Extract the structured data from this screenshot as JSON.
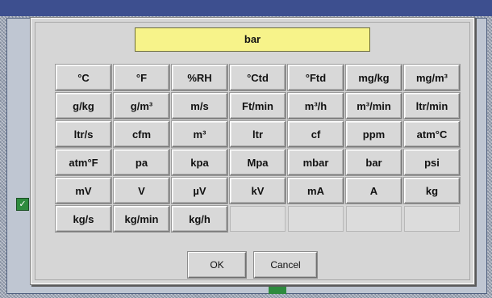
{
  "dialog": {
    "current_unit": "bar",
    "units": [
      "°C",
      "°F",
      "%RH",
      "°Ctd",
      "°Ftd",
      "mg/kg",
      "mg/m³",
      "g/kg",
      "g/m³",
      "m/s",
      "Ft/min",
      "m³/h",
      "m³/min",
      "ltr/min",
      "ltr/s",
      "cfm",
      "m³",
      "ltr",
      "cf",
      "ppm",
      "atm°C",
      "atm°F",
      "pa",
      "kpa",
      "Mpa",
      "mbar",
      "bar",
      "psi",
      "mV",
      "V",
      "µV",
      "kV",
      "mA",
      "A",
      "kg",
      "kg/s",
      "kg/min",
      "kg/h"
    ],
    "empty_slots": 4,
    "ok_label": "OK",
    "cancel_label": "Cancel"
  },
  "colors": {
    "title_field_bg": "#f7f38a",
    "dialog_bg": "#d6d6d6"
  }
}
